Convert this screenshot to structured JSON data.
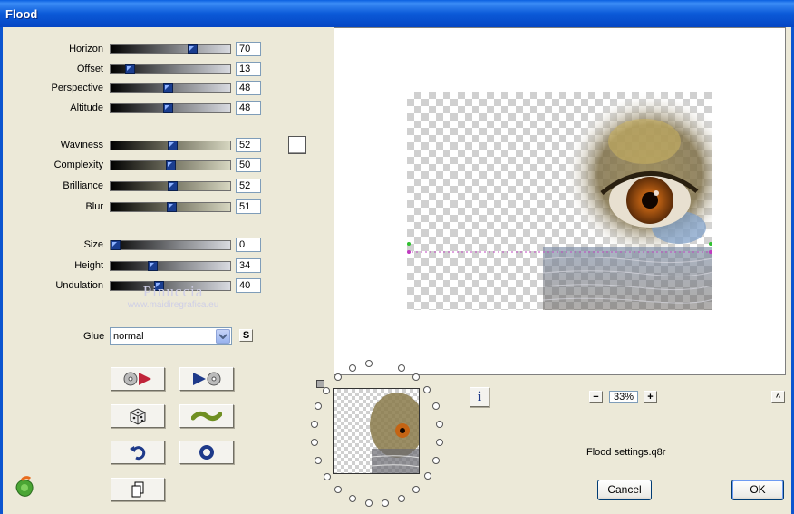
{
  "window": {
    "title": "Flood"
  },
  "sliders": [
    {
      "label": "Horizon",
      "value": "70",
      "fraction": 0.7
    },
    {
      "label": "Offset",
      "value": "13",
      "fraction": 0.13
    },
    {
      "label": "Perspective",
      "value": "48",
      "fraction": 0.48
    },
    {
      "label": "Altitude",
      "value": "48",
      "fraction": 0.48
    },
    {
      "label": "Waviness",
      "value": "52",
      "fraction": 0.52
    },
    {
      "label": "Complexity",
      "value": "50",
      "fraction": 0.5
    },
    {
      "label": "Brilliance",
      "value": "52",
      "fraction": 0.52
    },
    {
      "label": "Blur",
      "value": "51",
      "fraction": 0.51
    },
    {
      "label": "Size",
      "value": "0",
      "fraction": 0.0
    },
    {
      "label": "Height",
      "value": "34",
      "fraction": 0.34
    },
    {
      "label": "Undulation",
      "value": "40",
      "fraction": 0.4
    }
  ],
  "watermark": {
    "name": "Pinuccia",
    "site": "www.maidiregrafica.eu"
  },
  "glue": {
    "label": "Glue",
    "value": "normal",
    "s_button": "S"
  },
  "zoom": {
    "value": "33%",
    "minus": "−",
    "plus": "+"
  },
  "settings_file": "Flood settings.q8r",
  "buttons": {
    "cancel": "Cancel",
    "ok": "OK"
  },
  "icons": [
    "play-back-icon",
    "play-forward-icon",
    "dice-icon",
    "wave-icon",
    "undo-icon",
    "circle-icon",
    "copy-icon",
    "info-icon",
    "logo-icon",
    "collapse-icon"
  ],
  "colors": {
    "titlebar": "#0b5ad8",
    "window": "#ece9d8",
    "thumb": "#1a3d8f"
  }
}
